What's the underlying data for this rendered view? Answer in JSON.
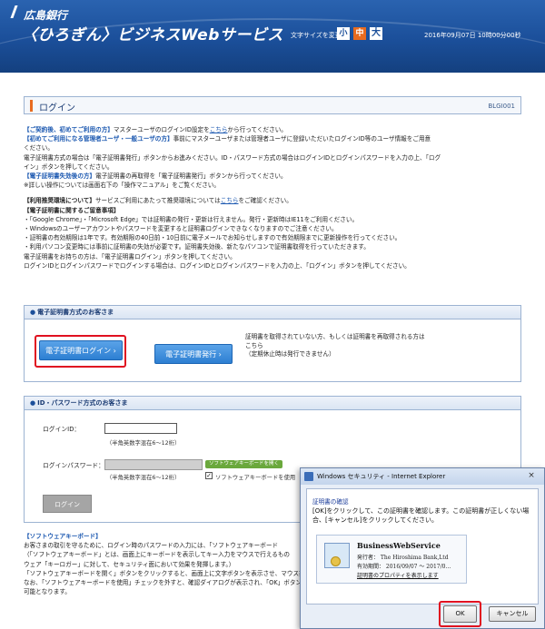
{
  "header": {
    "bank_name": "広島銀行",
    "service_name": "〈ひろぎん〉ビジネスWebサービス",
    "font_size_label": "文字サイズを変更",
    "font_sizes": [
      "小",
      "中",
      "大"
    ],
    "datetime": "2016年09月07日 10時00分00秒"
  },
  "page": {
    "title": "ログイン",
    "code": "BLGI001"
  },
  "intro": {
    "l1_head": "【ご契約後、初めてご利用の方】",
    "l1_a": "マスターユーザのログインID設定を",
    "l1_link": "こちら",
    "l1_b": "から行ってください。",
    "l2_head": "【初めてご利用になる管理者ユーザ・一般ユーザの方】",
    "l2_a": "事前にマスターユーザまたは管理者ユーザに登録いただいたログインID等のユーザ情報をご用意",
    "l2_b": "ください。",
    "l3": "電子証明書方式の場合は「電子証明書発行」ボタンからお進みください。ID・パスワード方式の場合はログインIDとログインパスワードを入力の上、「ログ",
    "l4": "イン」ボタンを押してください。",
    "l5_head": "【電子証明書失効後の方】",
    "l5_b": "電子証明書の再取得を「電子証明書発行」ボタンから行ってください。",
    "l6": "※詳しい操作については画面右下の「操作マニュアル」をご覧ください。",
    "l7_head": "【利用推奨環境について】",
    "l7_a": "サービスご利用にあたって推奨環境については",
    "l7_link": "こちら",
    "l7_b": "をご確認ください。",
    "l8_head": "【電子証明書に関するご留意事項】",
    "l9": "・「Google Chrome」・「Microsoft Edge」では証明書の発行・更新は行えません。発行・更新時はIE11をご利用ください。",
    "l10": "・Windowsのユーザーアカウントやパスワードを変更すると証明書ログインできなくなりますのでご注意ください。",
    "l11": "・証明書の有効期限は1年です。有効期限の40日前・10日前に電子メールでお知らせしますので有効期限までに更新操作を行ってください。",
    "l12": "・利用パソコン変更時には事前に証明書の失効が必要です。証明書失効後、新たなパソコンで証明書取得を行っていただきます。",
    "l13": "電子証明書をお持ちの方は、「電子証明書ログイン」ボタンを押してください。",
    "l14": "ログインIDとログインパスワードでログインする場合は、ログインIDとログインパスワードを入力の上、「ログイン」ボタンを押してください。"
  },
  "cert_panel": {
    "header": "電子証明書方式のお客さま",
    "login_button": "電子証明書ログイン",
    "issue_button": "電子証明書発行",
    "desc1": "証明書を取得されていない方、もしくは証明書を再取得される方は",
    "desc2": "こちら",
    "desc3": "（定期休止時は発行できません）"
  },
  "pw_panel": {
    "header": "ID・パスワード方式のお客さま",
    "id_label": "ログインID：",
    "id_hint": "（半角英数字混在6～12桁）",
    "pw_label": "ログインパスワード：",
    "pw_hint": "（半角英数字混在6～12桁）",
    "swkb_button": "ソフトウェアキーボードを開く",
    "swkb_check": "ソフトウェアキーボードを使用",
    "login_button": "ログイン"
  },
  "swkb_note": {
    "head": "【ソフトウェアキーボード】",
    "l1": "お客さまの取引を守るために、ログイン時のパスワードの入力には、「ソフトウェアキーボード",
    "l2": "（「ソフトウェアキーボード」とは、画面上にキーボードを表示してキー入力をマウスで行えるもの",
    "l3": "ウェア「キーロガー」に対して、セキュリティ面において効果を発揮します。）",
    "l4": "「ソフトウェアキーボードを開く」ボタンをクリックすると、画面上に文字ボタンを表示させ、マウス操作",
    "l5": "なお、「ソフトウェアキーボードを使用」チェックを外すと、確認ダイアログが表示され、「OK」ボタン",
    "l6": "可能となります。"
  },
  "dialog": {
    "title": "Windows セキュリティ - Internet Explorer",
    "close": "×",
    "heading": "証明書の確認",
    "message": "[OK]をクリックして、この証明書を確認します。この証明書が正しくない場合、[キャンセル]をクリックしてください。",
    "cert_name": "BusinessWebService",
    "issuer": "発行者： The Hiroshima Bank,Ltd",
    "validity": "有効期間： 2016/09/07 ～ 2017/0…",
    "properties_link": "証明書のプロパティを表示します",
    "ok": "OK",
    "cancel": "キャンセル"
  },
  "colors": {
    "brand_blue": "#1b4f9a",
    "accent_orange": "#e86b1f",
    "highlight_red": "#e01020"
  }
}
